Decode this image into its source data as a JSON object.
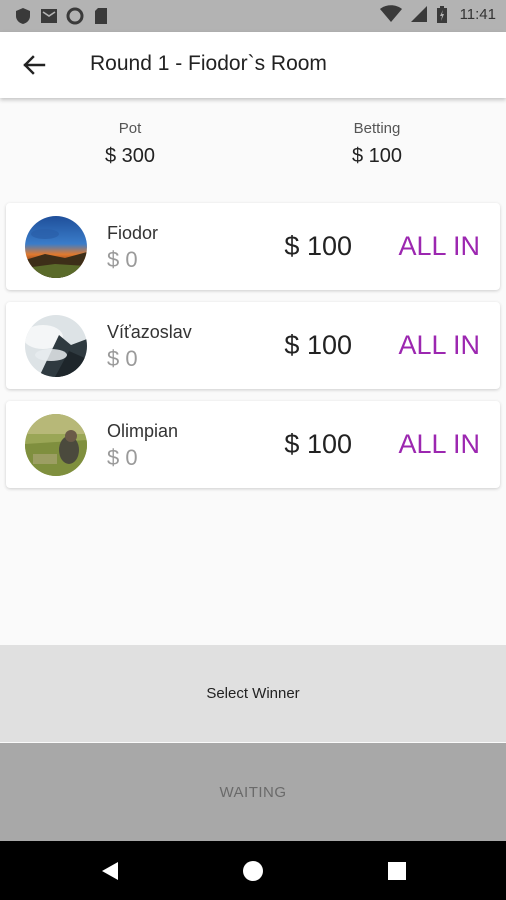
{
  "status_bar": {
    "time": "11:41",
    "left_icons": [
      "shield-icon",
      "mail-icon",
      "circle-icon",
      "sd-card-icon"
    ],
    "right_icons": [
      "wifi-icon",
      "signal-icon",
      "battery-icon"
    ]
  },
  "app_bar": {
    "title": "Round 1 - Fiodor`s Room",
    "back_icon": "arrow-left-icon"
  },
  "summary": {
    "pot_label": "Pot",
    "pot_value": "$ 300",
    "betting_label": "Betting",
    "betting_value": "$ 100"
  },
  "players": [
    {
      "name": "Fiodor",
      "chips": "$ 0",
      "bet": "$ 100",
      "status": "ALL IN"
    },
    {
      "name": "Víťazoslav",
      "chips": "$ 0",
      "bet": "$ 100",
      "status": "ALL IN"
    },
    {
      "name": "Olimpian",
      "chips": "$ 0",
      "bet": "$ 100",
      "status": "ALL IN"
    }
  ],
  "actions": {
    "select_winner": "Select Winner",
    "waiting": "WAITING"
  },
  "nav_bar": {
    "icons": [
      "back-triangle-icon",
      "home-circle-icon",
      "recents-square-icon"
    ]
  },
  "colors": {
    "accent": "#9c27b0",
    "status_bar": "#b3b3b3",
    "nav_bar": "#000000",
    "select_winner_bg": "#e0e0e0",
    "waiting_bg": "#a8a8a8"
  }
}
